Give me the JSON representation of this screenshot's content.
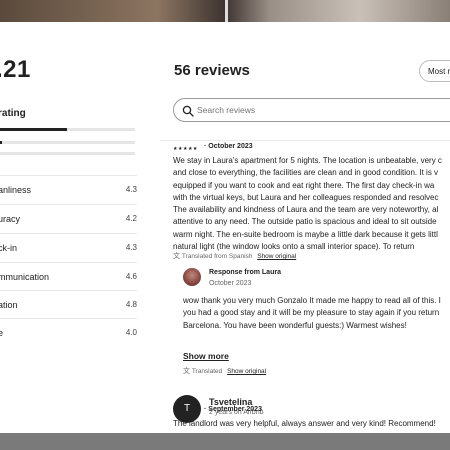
{
  "summary": {
    "rating_fragment": ".21",
    "overall_label": "rating",
    "overall_fill": 0.5,
    "star_distribution": [
      0.03,
      0.0
    ]
  },
  "categories": [
    {
      "label": "anliness",
      "value": "4.3"
    },
    {
      "label": "uracy",
      "value": "4.2"
    },
    {
      "label": "ck-in",
      "value": "4.3"
    },
    {
      "label": "mmunication",
      "value": "4.6"
    },
    {
      "label": "ation",
      "value": "4.8"
    },
    {
      "label": "e",
      "value": "4.0"
    }
  ],
  "header": {
    "reviews_title": "56 reviews",
    "sort_label": "Most re"
  },
  "search": {
    "placeholder": "Search reviews"
  },
  "review1": {
    "stars": "★★★★★",
    "date": "· October 2023",
    "lines": [
      "We stay in Laura's apartment for 5 nights. The location is unbeatable, very c",
      "and close to everything, the facilities are clean and in good condition. It is v",
      "equipped if you want to cook and eat right there. The first day check-in wa",
      "with the virtual keys, but Laura and her colleagues responded and resolvec",
      "The availability and kindness of Laura and the team are very noteworthy, al",
      "attentive to any need. The outside patio is spacious and ideal to sit outside",
      "warm night. The en-suite bedroom is maybe a little dark because it gets littl",
      "natural light (the window looks onto a small interior space). To return"
    ],
    "translated_text": "Translated from Spanish",
    "show_original": "Show original"
  },
  "response": {
    "title": "Response from Laura",
    "date": "October 2023",
    "lines": [
      "wow thank you very much Gonzalo It made me happy to read all of this. I",
      "you had a good stay and it will be my pleasure to stay again if you return",
      "Barcelona. You have been wonderful guests:) Warmest wishes!"
    ],
    "show_more": "Show more",
    "translated_text": "Translated",
    "show_original": "Show original"
  },
  "review2": {
    "avatar_initial": "T",
    "name": "Tsvetelina",
    "subtitle": "2 years on Airbnb",
    "stars": "★★★★★",
    "date": "· September 2023",
    "text": "The landlord was very helpful, always answer and very kind! Recommend!"
  }
}
